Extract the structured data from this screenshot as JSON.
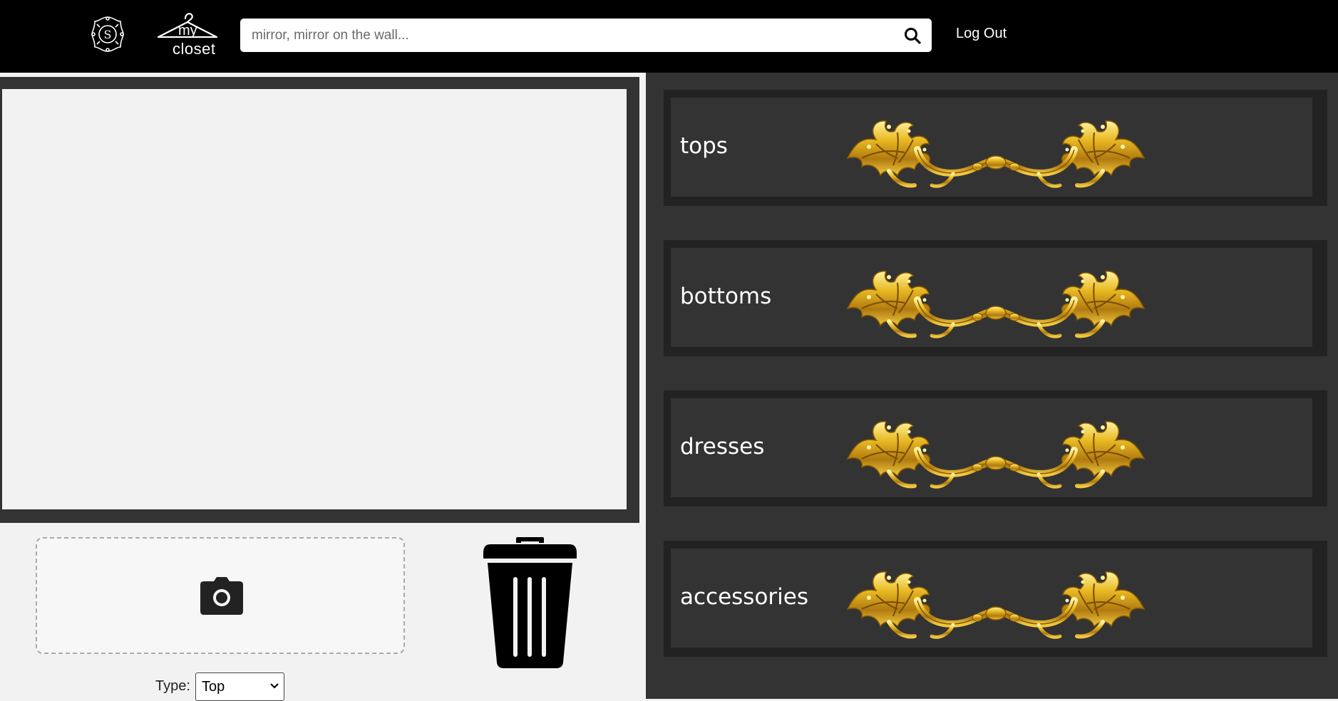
{
  "header": {
    "brand_mark_letter": "S",
    "logo_line1": "my",
    "logo_line2": "closet",
    "search_placeholder": "mirror, mirror on the wall...",
    "logout_label": "Log Out"
  },
  "editor": {
    "type_label": "Type:",
    "type_selected": "Top"
  },
  "drawers": [
    {
      "label": "tops"
    },
    {
      "label": "bottoms"
    },
    {
      "label": "dresses"
    },
    {
      "label": "accessories"
    }
  ],
  "icons": {
    "search": "search-icon",
    "camera": "camera-icon",
    "trash": "trash-icon",
    "handle": "ornate-gold-handle-icon"
  },
  "colors": {
    "header_bg": "#000000",
    "panel_bg": "#333333",
    "drawer_border": "#222222",
    "gold": "#d4a017"
  }
}
